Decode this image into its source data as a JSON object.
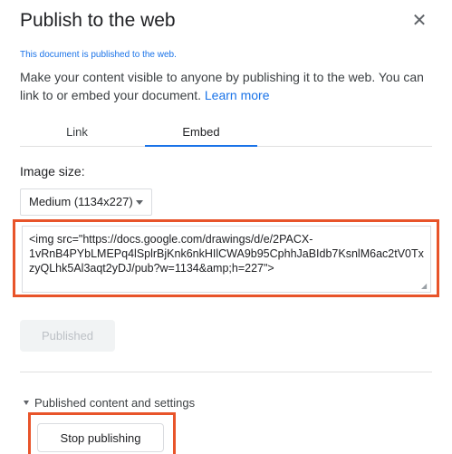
{
  "dialog": {
    "title": "Publish to the web",
    "close_icon": "close-icon",
    "status_text": "This document is published to the web.",
    "description": "Make your content visible to anyone by publishing it to the web. You can link to or embed your document. ",
    "learn_more": "Learn more"
  },
  "tabs": [
    {
      "label": "Link",
      "active": false
    },
    {
      "label": "Embed",
      "active": true
    }
  ],
  "embed": {
    "image_size_label": "Image size:",
    "image_size_value": "Medium (1134x227)",
    "code": "<img src=\"https://docs.google.com/drawings/d/e/2PACX-1vRnB4PYbLMEPq4lSplrBjKnk6nkHIlCWA9b95CphhJaBIdb7KsnlM6ac2tV0TxzyQLhk5Al3aqt2yDJ/pub?w=1134&amp;h=227\">"
  },
  "actions": {
    "published_label": "Published",
    "section_label": "Published content and settings",
    "stop_label": "Stop publishing"
  },
  "colors": {
    "accent": "#1a73e8",
    "highlight": "#e8542a"
  }
}
